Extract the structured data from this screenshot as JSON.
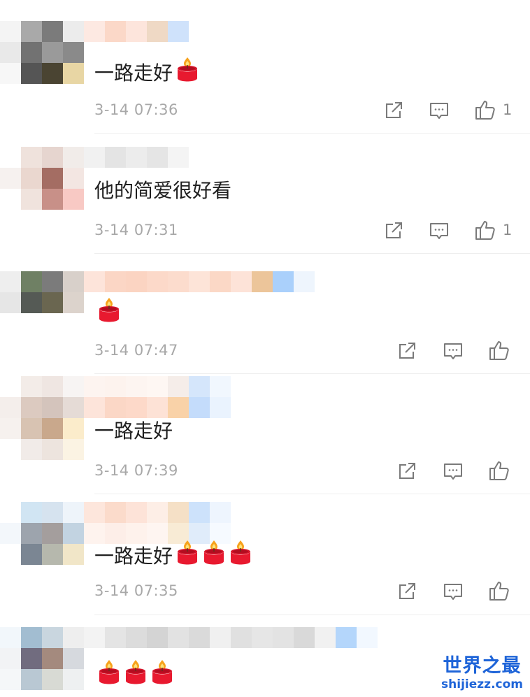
{
  "comments": [
    {
      "text": "一路走好",
      "candles": 1,
      "time": "3-14 07:36",
      "like_count": "1"
    },
    {
      "text": "他的简爱很好看",
      "candles": 0,
      "time": "3-14 07:31",
      "like_count": "1"
    },
    {
      "text": "",
      "candles": 1,
      "time": "3-14 07:47",
      "like_count": ""
    },
    {
      "text": "一路走好",
      "candles": 0,
      "time": "3-14 07:39",
      "like_count": ""
    },
    {
      "text": "一路走好",
      "candles": 3,
      "time": "3-14 07:35",
      "like_count": ""
    },
    {
      "text": "",
      "candles": 3,
      "time": "",
      "like_count": ""
    }
  ],
  "icons": {
    "share": "share-icon",
    "reply": "comment-icon",
    "like": "thumbs-up-icon",
    "candle": "candle-icon"
  },
  "watermark": {
    "title": "世界之最",
    "subtitle": "shijiezz.com"
  },
  "colors": {
    "watermark": "#1e64d8",
    "text": "#1f1f1f",
    "time": "#a8a8a8",
    "icon": "#7a7a7a"
  }
}
